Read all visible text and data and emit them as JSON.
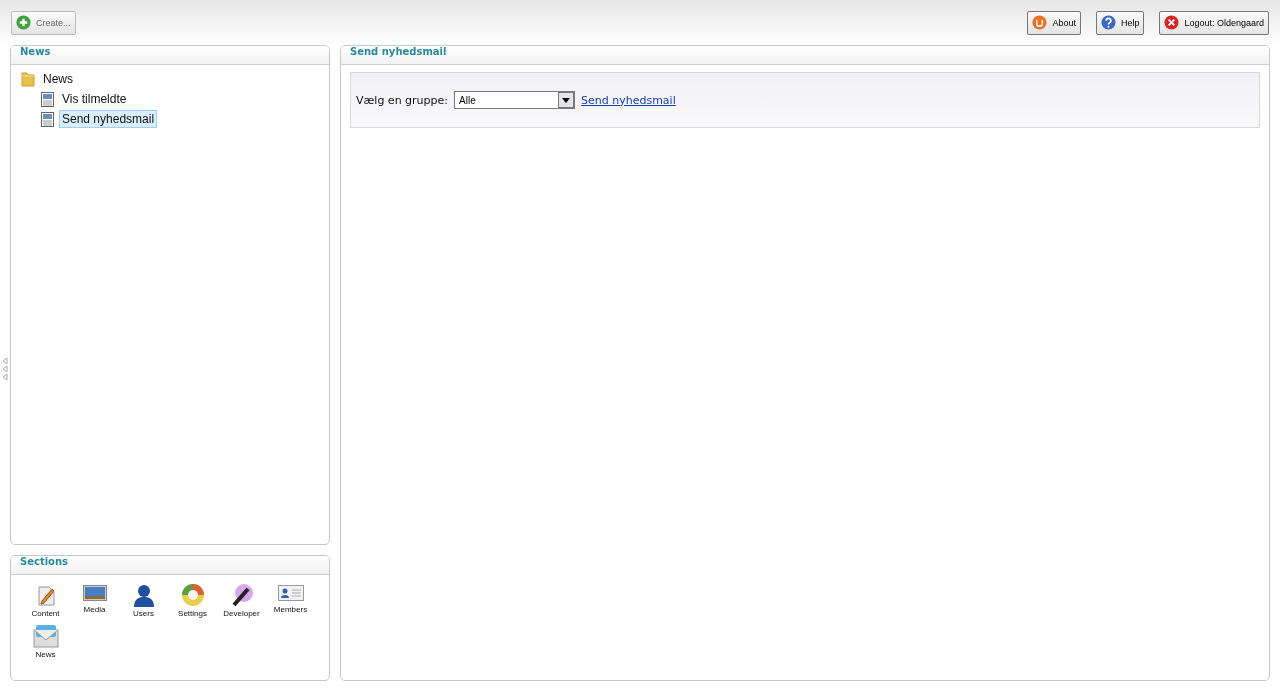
{
  "toolbar": {
    "create": "Create...",
    "buttons": [
      {
        "kind": "about",
        "label": "About"
      },
      {
        "kind": "help",
        "label": "Help"
      },
      {
        "kind": "logout",
        "label": "Logout: Oldengaard"
      }
    ]
  },
  "tree_panel": {
    "title": "News",
    "tree": [
      {
        "label": "News",
        "kind": "folder",
        "selected": false,
        "children": [
          {
            "label": "Vis tilmeldte",
            "kind": "page",
            "selected": false
          },
          {
            "label": "Send nyhedsmail",
            "kind": "page",
            "selected": true
          }
        ]
      }
    ]
  },
  "sections": {
    "title": "Sections",
    "items": [
      {
        "kind": "content",
        "label": "Content"
      },
      {
        "kind": "media",
        "label": "Media"
      },
      {
        "kind": "users",
        "label": "Users"
      },
      {
        "kind": "settings",
        "label": "Settings"
      },
      {
        "kind": "developer",
        "label": "Developer"
      },
      {
        "kind": "members",
        "label": "Members"
      },
      {
        "kind": "news",
        "label": "News"
      }
    ]
  },
  "main": {
    "title": "Send nyhedsmail",
    "group_label": "Vælg en gruppe:",
    "group_value": "Alle",
    "link": "Send nyhedsmail"
  }
}
